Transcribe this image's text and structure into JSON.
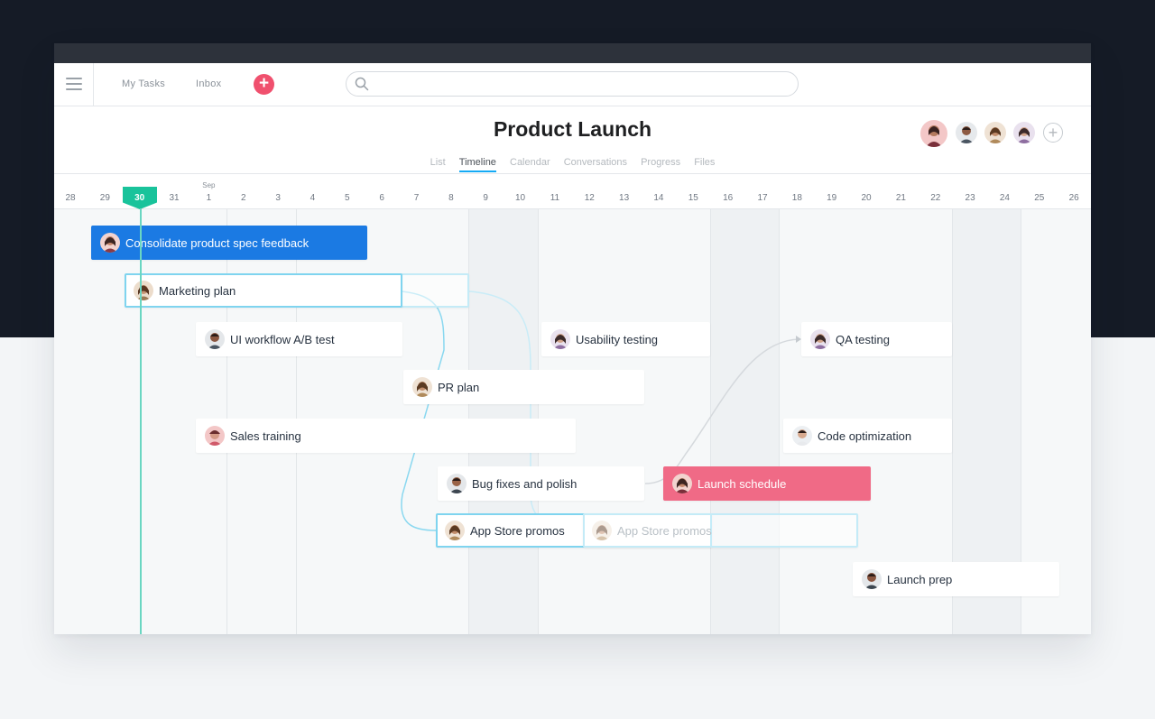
{
  "nav": {
    "my_tasks": "My Tasks",
    "inbox": "Inbox",
    "add_icon": "plus-icon",
    "search_placeholder": ""
  },
  "project": {
    "title": "Product Launch",
    "tabs": [
      {
        "label": "List",
        "active": false
      },
      {
        "label": "Timeline",
        "active": true
      },
      {
        "label": "Calendar",
        "active": false
      },
      {
        "label": "Conversations",
        "active": false
      },
      {
        "label": "Progress",
        "active": false
      },
      {
        "label": "Files",
        "active": false
      }
    ]
  },
  "timeline": {
    "month_label": "Sep",
    "days": [
      "28",
      "29",
      "30",
      "31",
      "1",
      "2",
      "3",
      "4",
      "5",
      "6",
      "7",
      "8",
      "9",
      "10",
      "11",
      "12",
      "13",
      "14",
      "15",
      "16",
      "17",
      "18",
      "19",
      "20",
      "21",
      "22",
      "23",
      "24",
      "25",
      "26"
    ],
    "today": "30"
  },
  "tasks": [
    {
      "name": "Consolidate product spec feedback",
      "style": "selected"
    },
    {
      "name": "Marketing plan",
      "style": "dragging"
    },
    {
      "name": "UI workflow A/B test",
      "style": "normal"
    },
    {
      "name": "Usability testing",
      "style": "normal"
    },
    {
      "name": "QA testing",
      "style": "normal"
    },
    {
      "name": "PR plan",
      "style": "normal"
    },
    {
      "name": "Sales training",
      "style": "normal"
    },
    {
      "name": "Code optimization",
      "style": "normal"
    },
    {
      "name": "Bug fixes and polish",
      "style": "normal"
    },
    {
      "name": "Launch schedule",
      "style": "milestone"
    },
    {
      "name": "App Store promos",
      "style": "dragging"
    },
    {
      "name": "App Store promos",
      "style": "ghost"
    },
    {
      "name": "Launch prep",
      "style": "normal"
    }
  ],
  "colors": {
    "accent_blue": "#1b7ae3",
    "accent_pink": "#f06a86",
    "today_green": "#19c39b",
    "add_button": "#f0506e",
    "dependency_line": "#7fd4ef"
  }
}
